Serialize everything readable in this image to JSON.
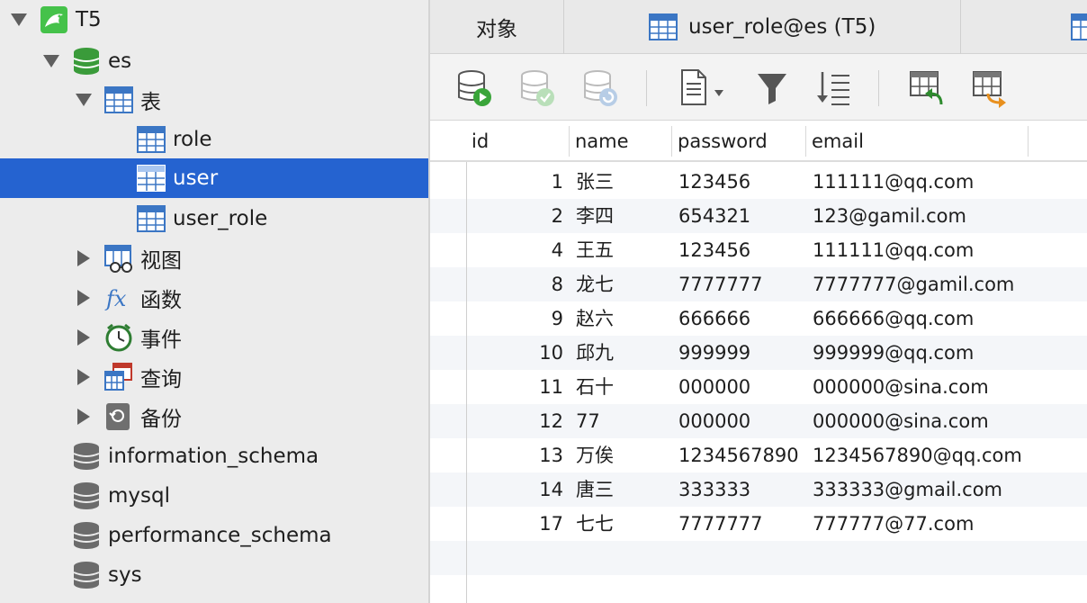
{
  "sidebar": {
    "connection": "T5",
    "database": "es",
    "tables_group": "表",
    "tables": [
      "role",
      "user",
      "user_role"
    ],
    "selected_table": "user",
    "groups": [
      "视图",
      "函数",
      "事件",
      "查询",
      "备份"
    ],
    "other_databases": [
      "information_schema",
      "mysql",
      "performance_schema",
      "sys"
    ]
  },
  "tabs": {
    "objects": "对象",
    "active": "user_role@es (T5)"
  },
  "toolbar": {
    "icons": [
      "open-table-icon",
      "apply-changes-icon",
      "refresh-icon",
      "new-query-icon",
      "filter-icon",
      "sort-icon",
      "import-icon",
      "export-icon"
    ]
  },
  "grid": {
    "columns": [
      "id",
      "name",
      "password",
      "email"
    ],
    "rows": [
      {
        "id": "1",
        "name": "张三",
        "password": "123456",
        "email": "111111@qq.com"
      },
      {
        "id": "2",
        "name": "李四",
        "password": "654321",
        "email": "123@gamil.com"
      },
      {
        "id": "4",
        "name": "王五",
        "password": "123456",
        "email": "111111@qq.com"
      },
      {
        "id": "8",
        "name": "龙七",
        "password": "7777777",
        "email": "7777777@gamil.com"
      },
      {
        "id": "9",
        "name": "赵六",
        "password": "666666",
        "email": "666666@qq.com"
      },
      {
        "id": "10",
        "name": "邱九",
        "password": "999999",
        "email": "999999@qq.com"
      },
      {
        "id": "11",
        "name": "石十",
        "password": "000000",
        "email": "000000@sina.com"
      },
      {
        "id": "12",
        "name": "77",
        "password": "000000",
        "email": "000000@sina.com"
      },
      {
        "id": "13",
        "name": "万俟",
        "password": "1234567890",
        "email": "1234567890@qq.com"
      },
      {
        "id": "14",
        "name": "唐三",
        "password": "333333",
        "email": "333333@gmail.com"
      },
      {
        "id": "17",
        "name": "七七",
        "password": "7777777",
        "email": "777777@77.com"
      }
    ]
  },
  "colors": {
    "selection": "#2563d0",
    "table_icon": "#3b76c4",
    "db_icon": "#3a9b3a"
  }
}
